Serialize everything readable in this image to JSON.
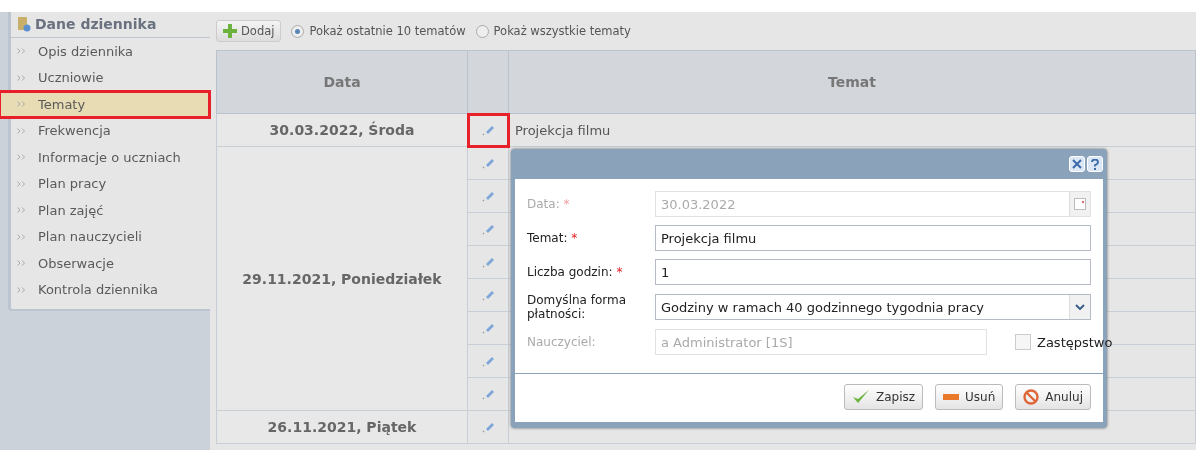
{
  "sidebar": {
    "title": "Dane dziennika",
    "items": [
      {
        "label": "Opis dziennika",
        "selected": false,
        "highlighted": false
      },
      {
        "label": "Uczniowie",
        "selected": false,
        "highlighted": false
      },
      {
        "label": "Tematy",
        "selected": true,
        "highlighted": true
      },
      {
        "label": "Frekwencja",
        "selected": false,
        "highlighted": false
      },
      {
        "label": "Informacje o uczniach",
        "selected": false,
        "highlighted": false
      },
      {
        "label": "Plan pracy",
        "selected": false,
        "highlighted": false
      },
      {
        "label": "Plan zajęć",
        "selected": false,
        "highlighted": false
      },
      {
        "label": "Plan nauczycieli",
        "selected": false,
        "highlighted": false
      },
      {
        "label": "Obserwacje",
        "selected": false,
        "highlighted": false
      },
      {
        "label": "Kontrola dziennika",
        "selected": false,
        "highlighted": false
      }
    ]
  },
  "toolbar": {
    "add_button": "Dodaj",
    "filters": [
      {
        "label": "Pokaż ostatnie 10 tematów",
        "selected": true
      },
      {
        "label": "Pokaż wszystkie tematy",
        "selected": false
      }
    ]
  },
  "table": {
    "columns": [
      "Data",
      "Temat"
    ],
    "groups": [
      {
        "date": "30.03.2022, Środa",
        "rows": [
          {
            "topic": "Projekcja filmu",
            "highlighted": true
          }
        ]
      },
      {
        "date": "29.11.2021, Poniedziałek",
        "rows": [
          {
            "highlighted": false
          },
          {
            "highlighted": false
          },
          {
            "highlighted": false
          },
          {
            "highlighted": false
          },
          {
            "highlighted": false
          },
          {
            "highlighted": false
          },
          {
            "highlighted": false
          },
          {
            "highlighted": false
          }
        ]
      },
      {
        "date": "26.11.2021, Piątek",
        "rows": [
          {
            "highlighted": false
          }
        ]
      }
    ]
  },
  "dialog": {
    "fields": [
      {
        "kind": "date",
        "label": "Data:",
        "required": "*",
        "disabled": true,
        "value": "30.03.2022"
      },
      {
        "kind": "text",
        "label": "Temat:",
        "required": "*",
        "disabled": false,
        "value": "Projekcja filmu"
      },
      {
        "kind": "text",
        "label": "Liczba godzin:",
        "required": "*",
        "disabled": false,
        "value": "1"
      },
      {
        "kind": "select",
        "label": "Domyślna forma płatności:",
        "disabled": false,
        "value": "Godziny w ramach 40 godzinnego tygodnia pracy"
      },
      {
        "kind": "teacher",
        "label": "Nauczyciel:",
        "disabled": true,
        "value": "a Administrator [1S]",
        "checkbox": {
          "label": "Zastępstwo",
          "checked": false
        }
      }
    ],
    "buttons": [
      {
        "kind": "save",
        "label": "Zapisz"
      },
      {
        "kind": "delete",
        "label": "Usuń"
      },
      {
        "kind": "cancel",
        "label": "Anuluj"
      }
    ]
  }
}
